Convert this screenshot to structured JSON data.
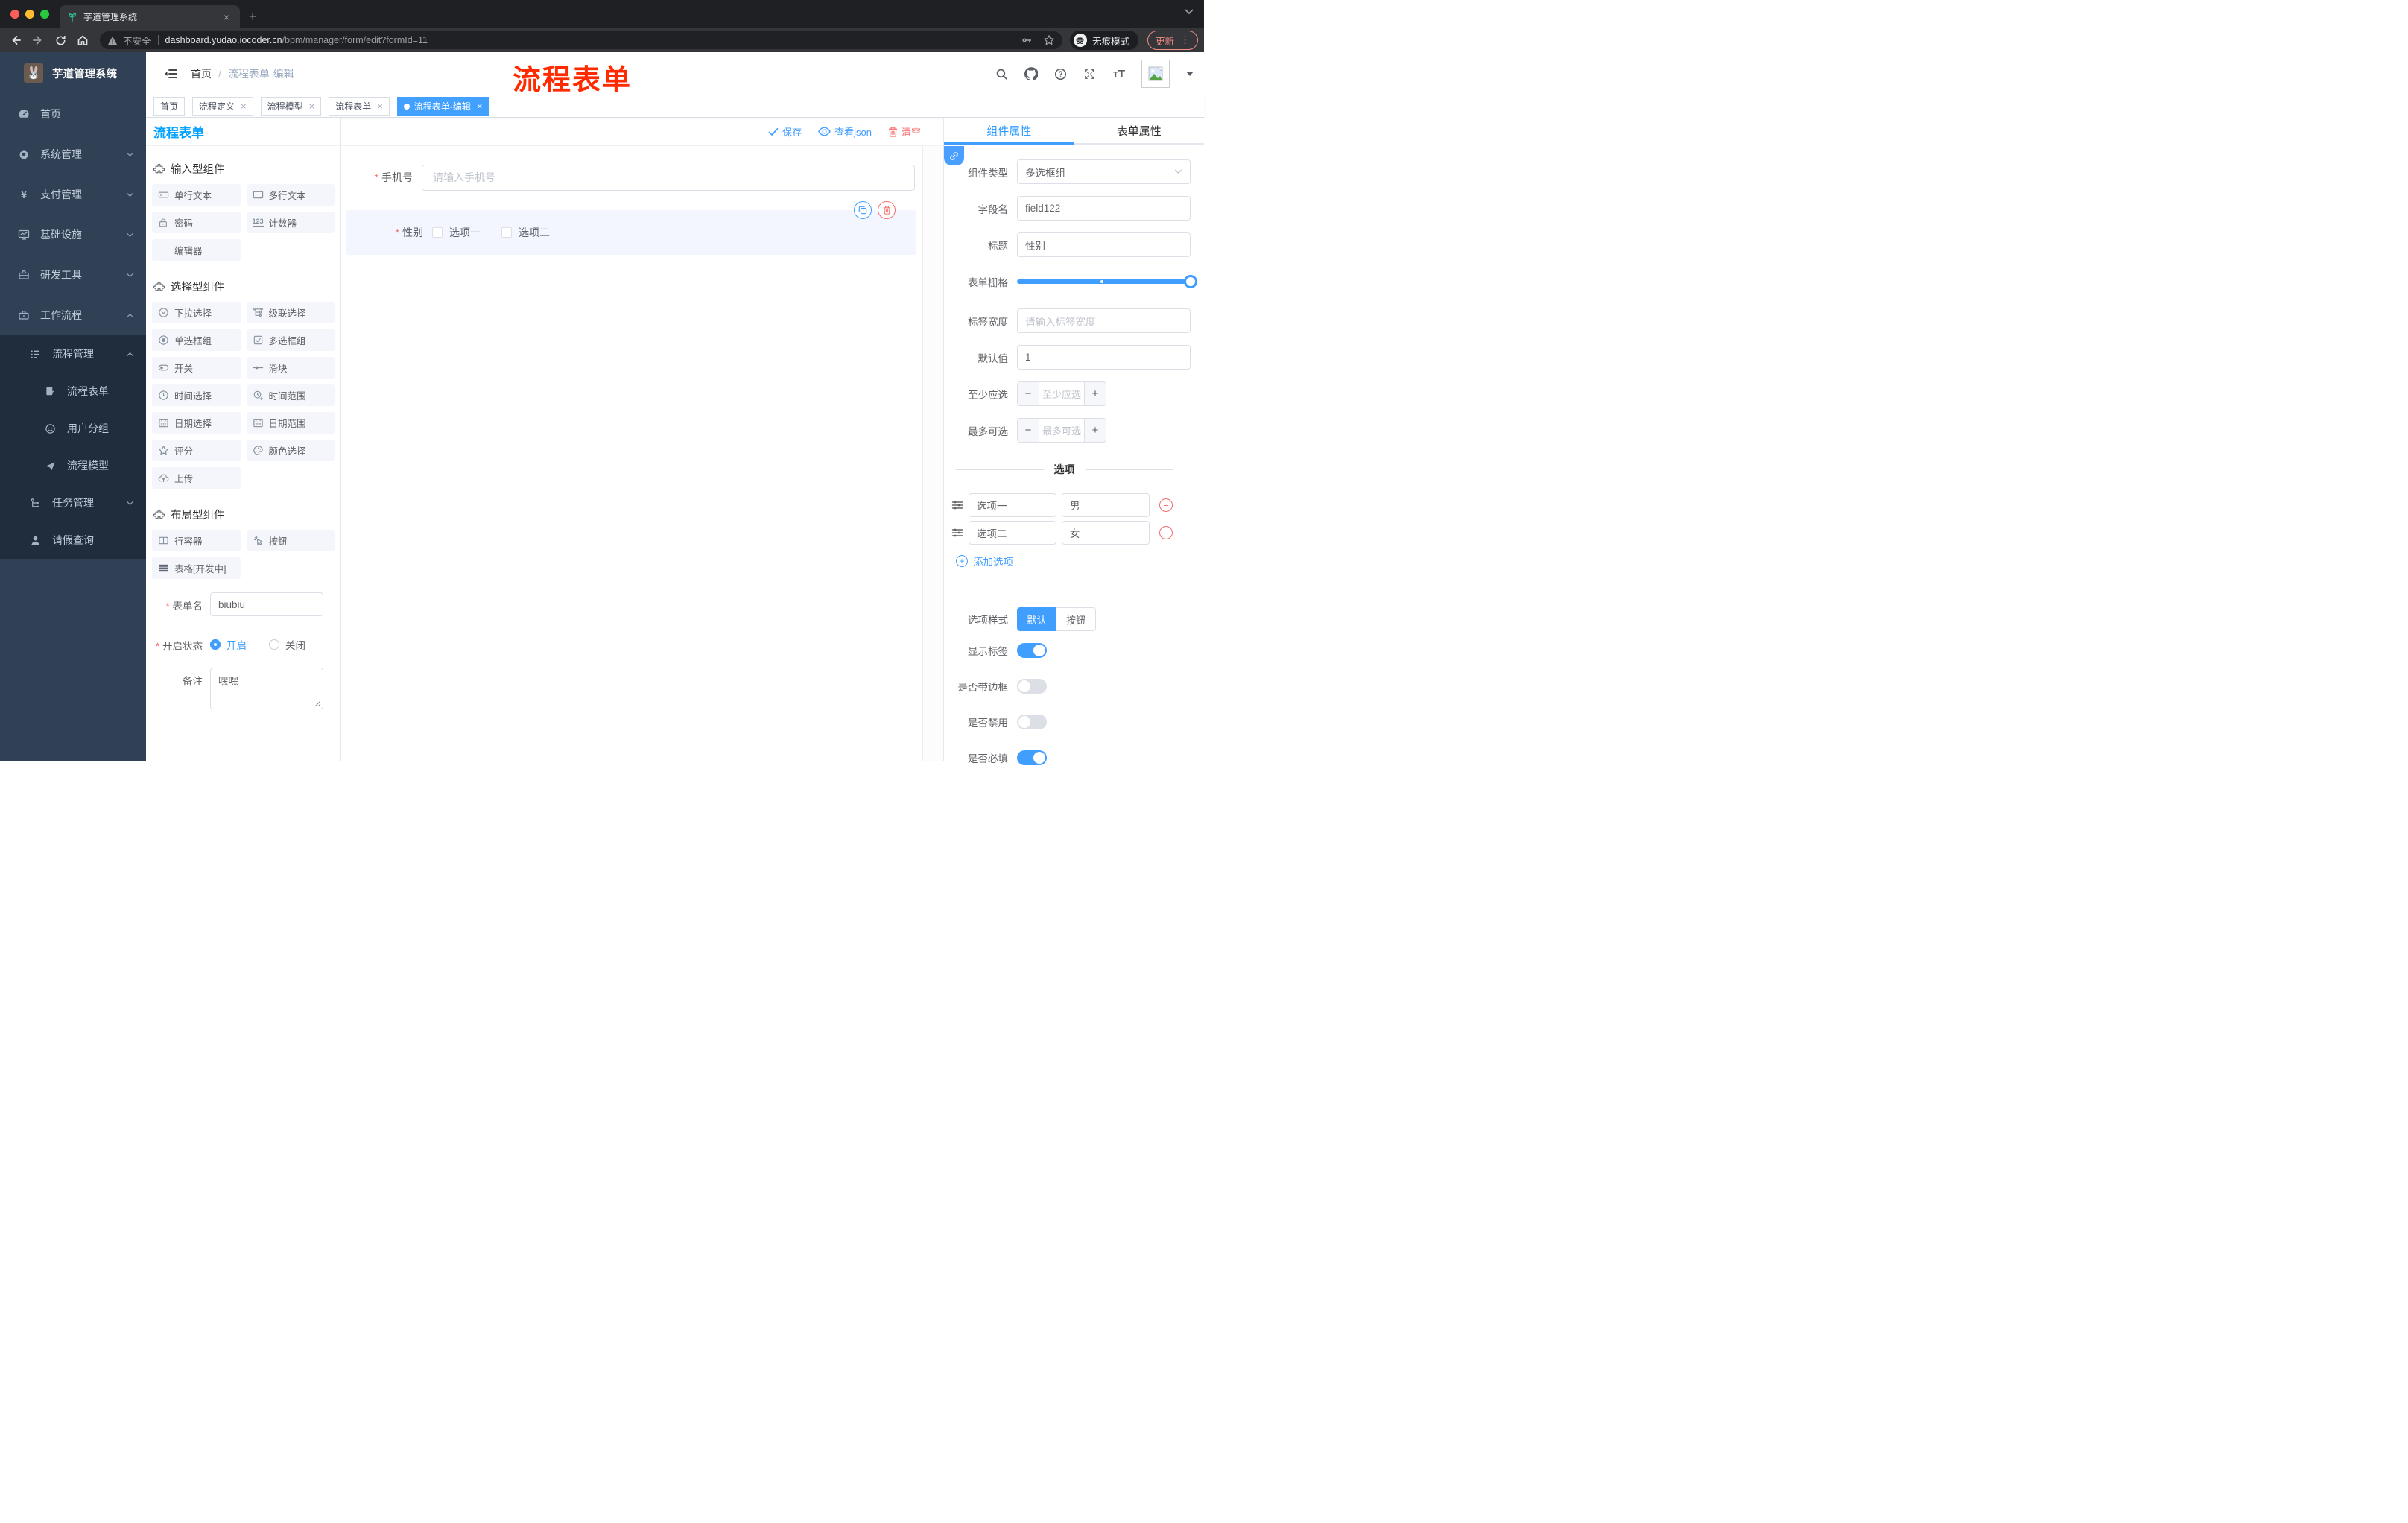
{
  "colors": {
    "accent": "#409eff",
    "danger": "#f56c6c",
    "panel_title_blue": "#00a2ff",
    "annotation_red": "#ff2a00",
    "sidebar_bg": "#304156",
    "sidebar_sub_bg": "#1f2d3d"
  },
  "glyphs": {
    "close": "×",
    "plus": "+",
    "minus": "−",
    "dots": "⋮",
    "slash": "/",
    "yen": "¥",
    "counter": "123",
    "font_size": "тT",
    "question": "?"
  },
  "browser": {
    "tab_title": "芋道管理系统",
    "address": {
      "security": "不安全",
      "host": "dashboard.yudao.iocoder.cn",
      "path": "/bpm/manager/form/edit?formId=11"
    },
    "incognito_label": "无痕模式",
    "update_label": "更新"
  },
  "sidebar": {
    "logo_title": "芋道管理系统",
    "items": [
      {
        "label": "首页"
      },
      {
        "label": "系统管理"
      },
      {
        "label": "支付管理"
      },
      {
        "label": "基础设施"
      },
      {
        "label": "研发工具"
      },
      {
        "label": "工作流程"
      },
      {
        "label": "流程管理"
      },
      {
        "label": "流程表单"
      },
      {
        "label": "用户分组"
      },
      {
        "label": "流程模型"
      },
      {
        "label": "任务管理"
      },
      {
        "label": "请假查询"
      }
    ]
  },
  "header": {
    "breadcrumb": {
      "root": "首页",
      "current": "流程表单-编辑"
    },
    "annotation": "流程表单"
  },
  "tags": {
    "items": [
      {
        "label": "首页"
      },
      {
        "label": "流程定义"
      },
      {
        "label": "流程模型"
      },
      {
        "label": "流程表单"
      },
      {
        "label": "流程表单-编辑"
      }
    ]
  },
  "palette": {
    "title": "流程表单",
    "groups": [
      {
        "title": "输入型组件",
        "items": [
          {
            "label": "单行文本"
          },
          {
            "label": "多行文本"
          },
          {
            "label": "密码"
          },
          {
            "label": "计数器"
          },
          {
            "label": "编辑器"
          }
        ]
      },
      {
        "title": "选择型组件",
        "items": [
          {
            "label": "下拉选择"
          },
          {
            "label": "级联选择"
          },
          {
            "label": "单选框组"
          },
          {
            "label": "多选框组"
          },
          {
            "label": "开关"
          },
          {
            "label": "滑块"
          },
          {
            "label": "时间选择"
          },
          {
            "label": "时间范围"
          },
          {
            "label": "日期选择"
          },
          {
            "label": "日期范围"
          },
          {
            "label": "评分"
          },
          {
            "label": "颜色选择"
          },
          {
            "label": "上传"
          }
        ]
      },
      {
        "title": "布局型组件",
        "items": [
          {
            "label": "行容器"
          },
          {
            "label": "按钮"
          },
          {
            "label": "表格[开发中]"
          }
        ]
      }
    ],
    "form": {
      "name_label": "表单名",
      "name_value": "biubiu",
      "status_label": "开启状态",
      "status_on": "开启",
      "status_off": "关闭",
      "remark_label": "备注",
      "remark_value": "嘿嘿"
    }
  },
  "canvas": {
    "toolbar": {
      "save": "保存",
      "view_json": "查看json",
      "clear": "清空"
    },
    "fields": [
      {
        "label": "手机号",
        "placeholder": "请输入手机号"
      },
      {
        "label": "性别",
        "options": [
          "选项一",
          "选项二"
        ]
      }
    ]
  },
  "panel": {
    "tabs": {
      "component": "组件属性",
      "form": "表单属性"
    },
    "rows": {
      "type_label": "组件类型",
      "type_value": "多选框组",
      "field_label": "字段名",
      "field_value": "field122",
      "title_label": "标题",
      "title_value": "性别",
      "grid_label": "表单栅格",
      "label_width_label": "标签宽度",
      "label_width_placeholder": "请输入标签宽度",
      "default_label": "默认值",
      "default_value": "1",
      "min_label": "至少应选",
      "min_placeholder": "至少应选",
      "max_label": "最多可选",
      "max_placeholder": "最多可选"
    },
    "options": {
      "divider": "选项",
      "rows": [
        {
          "label": "选项一",
          "value": "男"
        },
        {
          "label": "选项二",
          "value": "女"
        }
      ],
      "add": "添加选项"
    },
    "style": {
      "label": "选项样式",
      "default": "默认",
      "button": "按钮"
    },
    "switches": [
      {
        "label": "显示标签",
        "on": true
      },
      {
        "label": "是否带边框",
        "on": false
      },
      {
        "label": "是否禁用",
        "on": false
      },
      {
        "label": "是否必填",
        "on": true
      }
    ]
  }
}
